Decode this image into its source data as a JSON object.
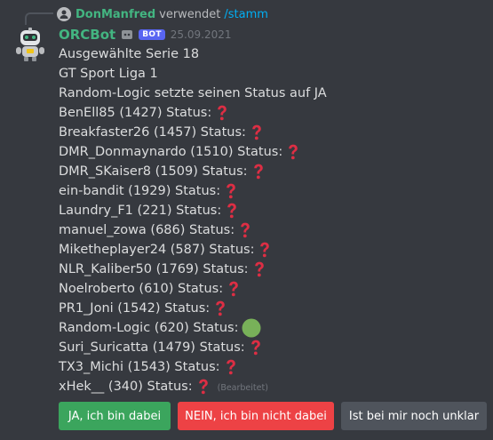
{
  "reply": {
    "user": "DonManfred",
    "verb": "verwendet",
    "command": "/stamm"
  },
  "message": {
    "author": "ORCBot",
    "badge": "BOT",
    "timestamp": "25.09.2021",
    "lines": [
      {
        "text": "Ausgewählte Serie 18",
        "emoji": null
      },
      {
        "text": "GT Sport Liga 1",
        "emoji": null
      },
      {
        "text": "Random-Logic setzte seinen Status auf JA",
        "emoji": null
      },
      {
        "text": "BenEll85 (1427) Status:",
        "emoji": "question-mark"
      },
      {
        "text": "Breakfaster26 (1457) Status:",
        "emoji": "question-mark"
      },
      {
        "text": "DMR_Donmaynardo (1510) Status:",
        "emoji": "question-mark"
      },
      {
        "text": "DMR_SKaiser8 (1509) Status:",
        "emoji": "question-mark"
      },
      {
        "text": "ein-bandit (1929) Status:",
        "emoji": "question-mark"
      },
      {
        "text": "Laundry_F1 (221) Status:",
        "emoji": "question-mark"
      },
      {
        "text": "manuel_zowa (686) Status:",
        "emoji": "question-mark"
      },
      {
        "text": "Miketheplayer24 (587) Status:",
        "emoji": "question-mark"
      },
      {
        "text": "NLR_Kaliber50 (1769) Status:",
        "emoji": "question-mark"
      },
      {
        "text": "Noelroberto (610) Status:",
        "emoji": "question-mark"
      },
      {
        "text": "PR1_Joni (1542) Status:",
        "emoji": "question-mark"
      },
      {
        "text": "Random-Logic (620) Status:",
        "emoji": "green-circle"
      },
      {
        "text": "Suri_Suricatta (1479) Status:",
        "emoji": "question-mark"
      },
      {
        "text": "TX3_Michi (1543) Status:",
        "emoji": "question-mark"
      },
      {
        "text": "xHek__ (340) Status:",
        "emoji": "question-mark"
      }
    ],
    "edited_label": "(Bearbeitet)"
  },
  "buttons": [
    {
      "label": "JA, ich bin dabei",
      "style": "green",
      "color": "#3ba55d"
    },
    {
      "label": "NEIN, ich bin nicht dabei",
      "style": "red",
      "color": "#ed4245"
    },
    {
      "label": "Ist bei mir noch unklar",
      "style": "grey",
      "color": "#4f545c"
    }
  ],
  "colors": {
    "background": "#36393f",
    "username": "#43b581",
    "command": "#00aff4",
    "bot_badge": "#5865f2"
  }
}
